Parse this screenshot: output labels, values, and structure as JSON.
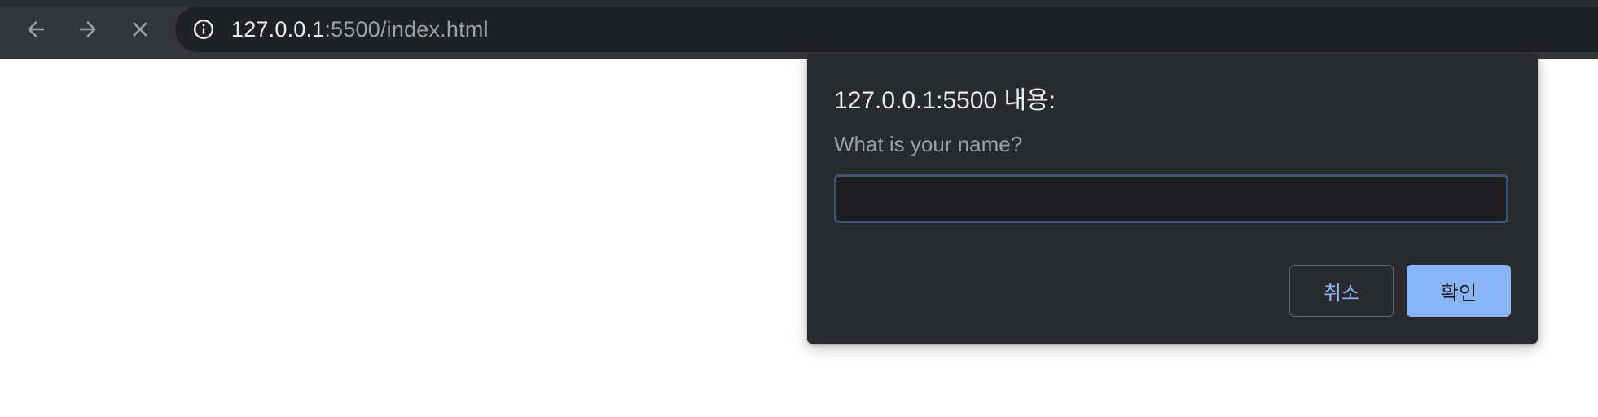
{
  "browser": {
    "nav": {
      "back_icon": "arrow-left-icon",
      "forward_icon": "arrow-right-icon",
      "stop_icon": "close-icon"
    },
    "omnibox": {
      "info_icon": "info-icon",
      "url_host": "127.0.0.1",
      "url_rest": ":5500/index.html"
    }
  },
  "dialog": {
    "title": "127.0.0.1:5500 내용:",
    "message": "What is your name?",
    "input_value": "",
    "cancel_label": "취소",
    "ok_label": "확인"
  },
  "colors": {
    "toolbar": "#35363a",
    "omnibox": "#202124",
    "dialog_bg": "#292a2d",
    "accent": "#8ab4f8",
    "input_border": "#3d5573",
    "page_bg": "#ffffff"
  }
}
